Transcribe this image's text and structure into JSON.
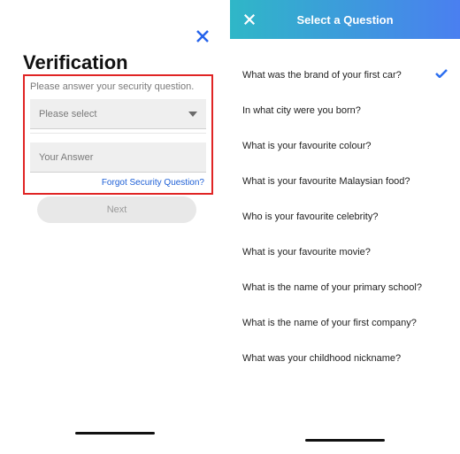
{
  "left": {
    "title": "Verification",
    "instruction": "Please answer your security question.",
    "select_placeholder": "Please select",
    "answer_placeholder": "Your Answer",
    "forgot_link": "Forgot Security Question?",
    "next_label": "Next"
  },
  "right": {
    "header_title": "Select a Question",
    "questions": [
      {
        "text": "What was the brand of your first car?",
        "selected": true
      },
      {
        "text": "In what city were you born?",
        "selected": false
      },
      {
        "text": "What is your favourite colour?",
        "selected": false
      },
      {
        "text": "What is your favourite Malaysian food?",
        "selected": false
      },
      {
        "text": "Who is your favourite celebrity?",
        "selected": false
      },
      {
        "text": "What is your favourite movie?",
        "selected": false
      },
      {
        "text": "What is the name of your primary school?",
        "selected": false
      },
      {
        "text": "What is the name of your first company?",
        "selected": false
      },
      {
        "text": "What was your childhood nickname?",
        "selected": false
      }
    ]
  }
}
